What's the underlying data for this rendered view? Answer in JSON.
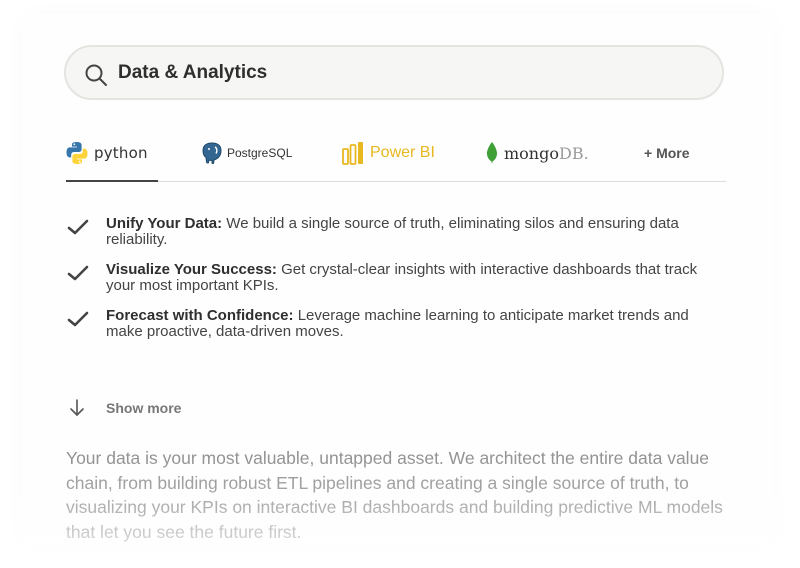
{
  "search": {
    "value": "Data & Analytics",
    "icon": "search-icon"
  },
  "tabs": [
    {
      "label": "python",
      "icon": "python-logo-icon",
      "active": true
    },
    {
      "label": "PostgreSQL",
      "icon": "postgresql-elephant-icon",
      "active": false
    },
    {
      "label": "Power BI",
      "icon": "powerbi-logo-icon",
      "active": false
    },
    {
      "label_main": "mongo",
      "label_suffix": "DB.",
      "icon": "mongodb-leaf-icon",
      "active": false
    },
    {
      "label": "+ More",
      "active": false
    }
  ],
  "features": [
    {
      "title": "Unify Your Data:",
      "text": " We build a single source of truth, eliminating silos and ensuring data reliability."
    },
    {
      "title": "Visualize Your Success:",
      "text": " Get crystal-clear insights with interactive dashboards that track your most important KPIs."
    },
    {
      "title": "Forecast with Confidence:",
      "text": " Leverage machine learning to anticipate market trends and make proactive, data-driven moves."
    }
  ],
  "show_more": {
    "label": "Show more",
    "icon": "arrow-down-icon"
  },
  "description": "Your data is your most valuable, untapped asset. We architect the entire data value chain, from building robust ETL pipelines and creating a single source of truth, to visualizing your KPIs on interactive BI dashboards and building predictive ML models that let you see the future first.",
  "colors": {
    "powerbi": "#e8b820",
    "mongodb_leaf": "#3fa037",
    "postgres": "#336791",
    "python_blue": "#3776ab",
    "python_yellow": "#ffd43b"
  }
}
